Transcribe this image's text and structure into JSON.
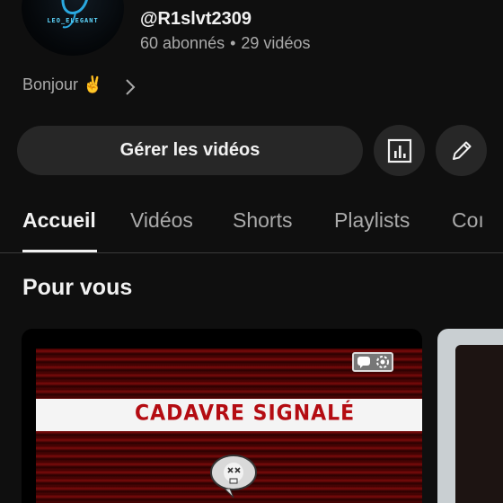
{
  "channel": {
    "avatar_text": "LEO_ELEGANT",
    "handle": "@R1slvt2309",
    "subscribers": "60 abonnés",
    "separator": "•",
    "videos_count": "29 vidéos",
    "bio": "Bonjour ✌️"
  },
  "actions": {
    "manage_label": "Gérer les vidéos",
    "analytics_icon": "analytics-icon",
    "edit_icon": "pencil-icon"
  },
  "tabs": [
    {
      "label": "Accueil",
      "active": true
    },
    {
      "label": "Vidéos",
      "active": false
    },
    {
      "label": "Shorts",
      "active": false
    },
    {
      "label": "Playlists",
      "active": false
    },
    {
      "label": "Coı",
      "active": false
    }
  ],
  "section": {
    "title": "Pour vous"
  },
  "video": {
    "banner_text": "CADAVRE SIGNALÉ"
  },
  "colors": {
    "background": "#0f0f0f",
    "button": "#272727",
    "text_primary": "#f1f1f1",
    "text_secondary": "#aaaaaa"
  }
}
